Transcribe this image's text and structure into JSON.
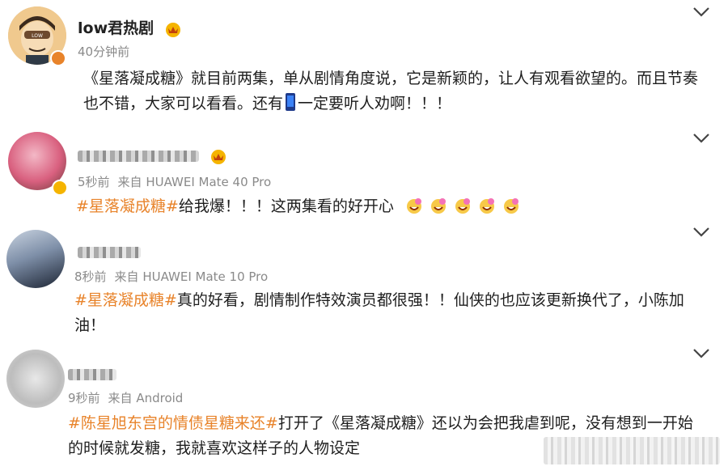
{
  "posts": [
    {
      "username": "low君热剧",
      "time": "40分钟前",
      "source": "",
      "segments": [
        {
          "text": "《星落凝成糖》就目前两集，单从剧情角度说，它是新颖的，让人有观看欲望的。而且节奏也不错，大家可以看看。还有",
          "tag": false
        },
        {
          "text": "",
          "tag": false,
          "icon": "phone-emoji"
        },
        {
          "text": "一定要听人劝啊！！！",
          "tag": false
        }
      ]
    },
    {
      "username": "",
      "time": "5秒前",
      "source": "来自 HUAWEI Mate 40 Pro",
      "segments": [
        {
          "text": "#星落凝成糖#",
          "tag": true
        },
        {
          "text": "给我爆！！！这两集看的好开心",
          "tag": false
        }
      ]
    },
    {
      "username": "",
      "time": "8秒前",
      "source": "来自 HUAWEI Mate 10 Pro",
      "segments": [
        {
          "text": "#星落凝成糖#",
          "tag": true
        },
        {
          "text": "真的好看，剧情制作特效演员都很强！！仙侠的也应该更新换代了，小陈加油！",
          "tag": false
        }
      ]
    },
    {
      "username": "",
      "time": "9秒前",
      "source": "来自 Android",
      "segments": [
        {
          "text": "#陈星旭东宫的情债星糖来还#",
          "tag": true
        },
        {
          "text": "打开了《星落凝成糖》还以为会把我虐到呢，没有想到一开始的时候就发糖，我就喜欢这样子的人物设定",
          "tag": false
        }
      ]
    }
  ],
  "colors": {
    "topic": "#e8832a",
    "meta": "#8a8a8a",
    "verified": "#e8832a",
    "vip": "#f5b400"
  },
  "icons": {
    "more": "chevron-down-icon",
    "emoji": "flower-laugh-emoji",
    "vip": "vip-crown-icon"
  }
}
